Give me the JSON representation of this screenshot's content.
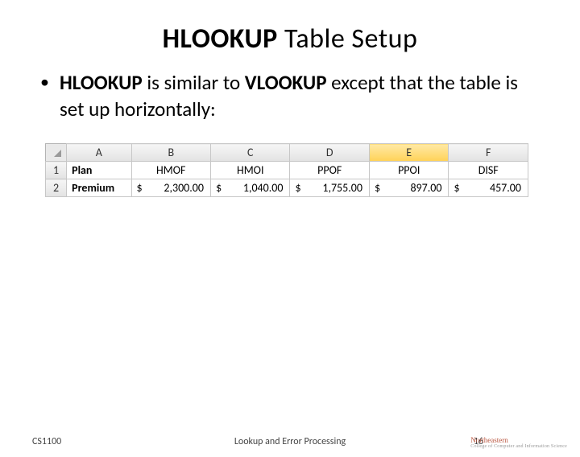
{
  "title": {
    "bold": "HLOOKUP",
    "rest": " Table Setup"
  },
  "bullet": {
    "pre": "HLOOKUP",
    "mid": " is similar to ",
    "post": "VLOOKUP",
    "tail": " except that the table is set up horizontally:"
  },
  "sheet": {
    "columns": [
      "A",
      "B",
      "C",
      "D",
      "E",
      "F"
    ],
    "rows": [
      "1",
      "2"
    ],
    "selectedCol": "E",
    "row1_label": "Plan",
    "row2_label": "Premium",
    "plans": [
      "HMOF",
      "HMOI",
      "PPOF",
      "PPOI",
      "DISF"
    ],
    "premiums": [
      "2,300.00",
      "1,040.00",
      "1,755.00",
      "897.00",
      "457.00"
    ],
    "currency": "$"
  },
  "footer": {
    "left": "CS1100",
    "center": "Lookup and Error Processing",
    "page": "16",
    "logo_top": "Northeastern",
    "logo_sub": "College of Computer and Information Science"
  }
}
